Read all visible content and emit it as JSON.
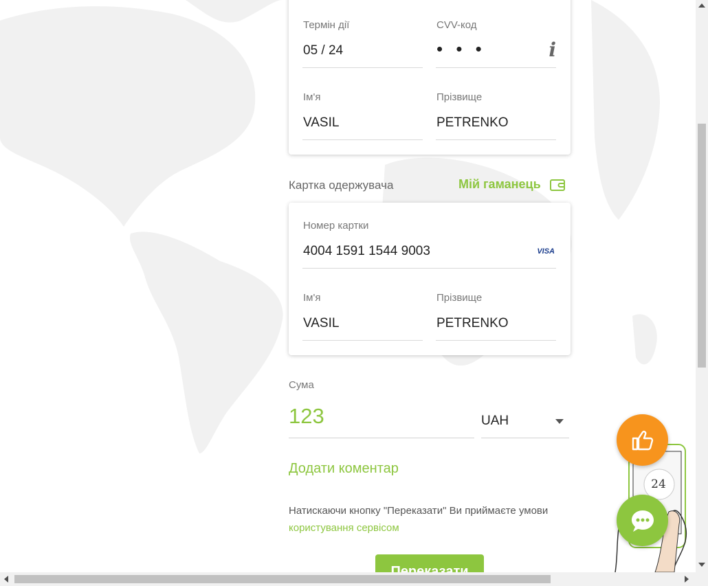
{
  "sender_card": {
    "expiry_label": "Термін дії",
    "expiry_value": "05 / 24",
    "cvv_label": "CVV-код",
    "cvv_value": "• • •",
    "cvv_info": "i",
    "first_name_label": "Ім'я",
    "first_name_value": "VASIL",
    "last_name_label": "Прізвище",
    "last_name_value": "PETRENKO"
  },
  "recipient": {
    "section_label": "Картка одержувача",
    "wallet_link": "Мій гаманець",
    "card_number_label": "Номер картки",
    "card_number_value": "4004 1591 1544 9003",
    "card_brand": "VISA",
    "first_name_label": "Ім'я",
    "first_name_value": "VASIL",
    "last_name_label": "Прізвище",
    "last_name_value": "PETRENKO"
  },
  "amount": {
    "label": "Сума",
    "value": "123",
    "currency": "UAH"
  },
  "comment_link": "Додати коментар",
  "terms": {
    "text": "Натискаючи кнопку \"Переказати\" Ви приймаєте умови ",
    "link": "користування сервісом"
  },
  "submit_label": "Переказати",
  "support_badge": "24",
  "colors": {
    "accent": "#8dc63f",
    "orange": "#f7941d",
    "visa": "#1a3c8c"
  }
}
